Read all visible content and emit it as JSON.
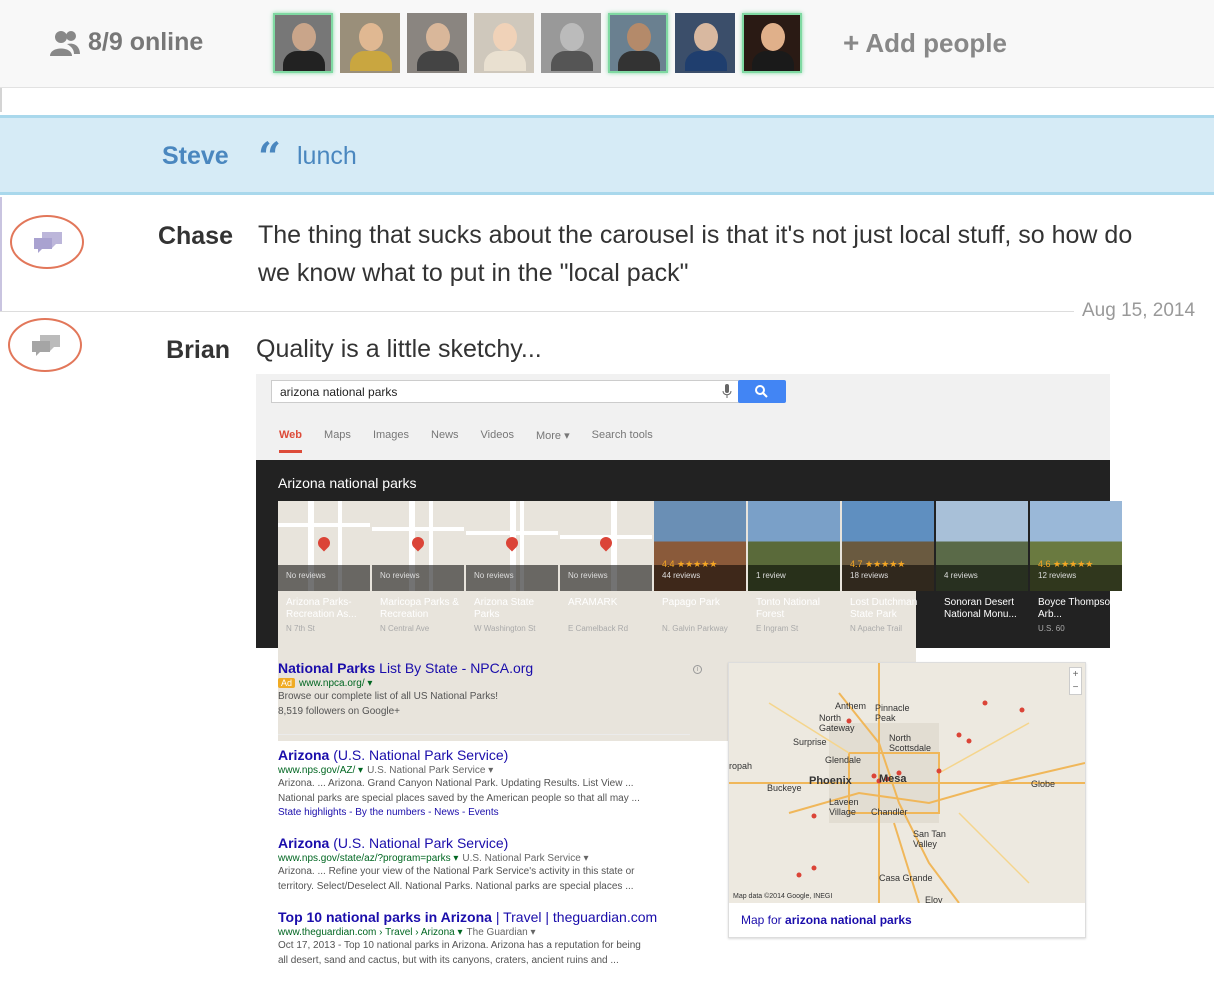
{
  "topbar": {
    "online_text": "8/9 online",
    "add_people_label": "Add people",
    "avatars": [
      {
        "name": "avatar-1",
        "online": true,
        "skin": "#c9a58a",
        "shirt": "#222",
        "bg": "#777"
      },
      {
        "name": "avatar-2",
        "online": false,
        "skin": "#e0b892",
        "shirt": "#c9a640",
        "bg": "#9a8f7a"
      },
      {
        "name": "avatar-3",
        "online": false,
        "skin": "#d9b79a",
        "shirt": "#444",
        "bg": "#8a8580"
      },
      {
        "name": "avatar-4",
        "online": false,
        "skin": "#f0d2b8",
        "shirt": "#e9e0d0",
        "bg": "#cfc8bc"
      },
      {
        "name": "avatar-5",
        "online": false,
        "skin": "#bbbbbb",
        "shirt": "#555",
        "bg": "#999"
      },
      {
        "name": "avatar-6",
        "online": true,
        "skin": "#b48a6a",
        "shirt": "#333",
        "bg": "#6a8090"
      },
      {
        "name": "avatar-7",
        "online": false,
        "skin": "#d8b8a0",
        "shirt": "#1f3e6e",
        "bg": "#3b4e6a"
      },
      {
        "name": "avatar-8",
        "online": true,
        "skin": "#e0b08a",
        "shirt": "#1a1a1a",
        "bg": "#2a1a14"
      }
    ]
  },
  "quote": {
    "author": "Steve",
    "text": "lunch"
  },
  "messages": {
    "chase": {
      "author": "Chase",
      "line1": "The thing that sucks about the carousel is that it's not just local stuff, so how do",
      "line2": "we know what to put in the \"local pack\""
    },
    "date": "Aug 15, 2014",
    "brian": {
      "author": "Brian",
      "text": "Quality is a little sketchy..."
    }
  },
  "google": {
    "query": "arizona national parks",
    "tabs": [
      "Web",
      "Maps",
      "Images",
      "News",
      "Videos",
      "More",
      "Search tools"
    ],
    "carousel_title": "Arizona national parks",
    "carousel": [
      {
        "name": "Arizona Parks-Recreation As...",
        "addr": "N 7th St",
        "reviews": "No reviews",
        "stars": "",
        "type": "map"
      },
      {
        "name": "Maricopa Parks & Recreation",
        "addr": "N Central Ave",
        "reviews": "No reviews",
        "stars": "",
        "type": "map"
      },
      {
        "name": "Arizona State Parks",
        "addr": "W Washington St",
        "reviews": "No reviews",
        "stars": "",
        "type": "map"
      },
      {
        "name": "ARAMARK",
        "addr": "E Camelback Rd",
        "reviews": "No reviews",
        "stars": "",
        "type": "map"
      },
      {
        "name": "Papago Park",
        "addr": "N. Galvin Parkway",
        "reviews": "44 reviews",
        "stars": "4.4 ★★★★★",
        "type": "photo",
        "sky": "#6a8fb5",
        "ground": "#8a5a3a"
      },
      {
        "name": "Tonto National Forest",
        "addr": "E Ingram St",
        "reviews": "1 review",
        "stars": "",
        "type": "photo",
        "sky": "#7aa0c8",
        "ground": "#5a6a3a"
      },
      {
        "name": "Lost Dutchman State Park",
        "addr": "N Apache Trail",
        "reviews": "18 reviews",
        "stars": "4.7 ★★★★★",
        "type": "photo",
        "sky": "#5f8fc0",
        "ground": "#6a5a40"
      },
      {
        "name": "Sonoran Desert National Monu...",
        "addr": "",
        "reviews": "4 reviews",
        "stars": "",
        "type": "photo",
        "sky": "#a8c0d8",
        "ground": "#5a6a48"
      },
      {
        "name": "Boyce Thompson Arb...",
        "addr": "U.S. 60",
        "reviews": "12 reviews",
        "stars": "4.6 ★★★★★",
        "type": "photo",
        "sky": "#9ab8d8",
        "ground": "#6a7a40"
      }
    ],
    "results": [
      {
        "title_a": "National Parks",
        "title_b": " List By State - NPCA.org",
        "ad": "Ad",
        "url": "www.npca.org/",
        "snip1": "Browse our complete list of all US National Parks!",
        "snip2": "8,519 followers on Google+"
      },
      {
        "title_a": "Arizona",
        "title_b": " (U.S. National Park Service)",
        "url": "www.nps.gov/AZ/",
        "crumb": "U.S. National Park Service",
        "snip1": "Arizona. ... Arizona. Grand Canyon National Park. Updating Results. List View ...",
        "snip2": "National parks are special places saved by the American people so that all may ...",
        "sub": "State highlights - By the numbers - News - Events"
      },
      {
        "title_a": "Arizona",
        "title_b": " (U.S. National Park Service)",
        "url": "www.nps.gov/state/az/?program=parks",
        "crumb": "U.S. National Park Service",
        "snip1": "Arizona. ... Refine your view of the National Park Service's activity in this state or",
        "snip2": "territory. Select/Deselect All. National Parks. National parks are special places ..."
      },
      {
        "title_a": "Top 10 national parks in Arizona",
        "title_b": " | Travel | theguardian.com",
        "url": "www.theguardian.com › Travel › Arizona",
        "crumb": "The Guardian",
        "snip1": "Oct 17, 2013 - Top 10 national parks in Arizona. Arizona has a reputation for being",
        "snip2": "all desert, sand and cactus, but with its canyons, craters, ancient ruins and ..."
      }
    ],
    "map": {
      "labels": [
        "Anthem",
        "Pinnacle Peak",
        "North Gateway",
        "Surprise",
        "North Scottsdale",
        "Glendale",
        "Phoenix",
        "Mesa",
        "Buckeye",
        "Globe",
        "Laveen Village",
        "Chandler",
        "San Tan Valley",
        "Casa Grande",
        "Eloy",
        "ropah"
      ],
      "credit": "Map data ©2014 Google, INEGI",
      "caption_a": "Map for ",
      "caption_b": "arizona national parks"
    }
  }
}
